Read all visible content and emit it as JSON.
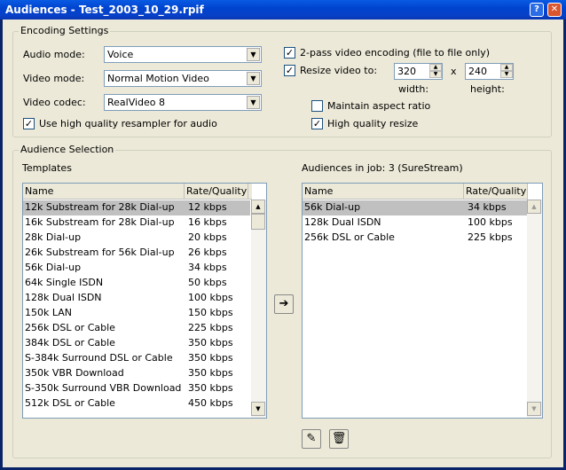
{
  "window": {
    "title": "Audiences - Test_2003_10_29.rpif",
    "help_glyph": "?",
    "close_glyph": "✕"
  },
  "encoding": {
    "group_label": "Encoding Settings",
    "audio_mode_label": "Audio mode:",
    "audio_mode_value": "Voice",
    "video_mode_label": "Video mode:",
    "video_mode_value": "Normal Motion Video",
    "video_codec_label": "Video codec:",
    "video_codec_value": "RealVideo 8",
    "resampler_label": "Use high quality resampler for audio",
    "resampler_checked": true,
    "twopass_label": "2-pass video encoding (file to file only)",
    "twopass_checked": true,
    "resize_label": "Resize video to:",
    "resize_checked": true,
    "width_value": "320",
    "height_value": "240",
    "x_sep": "x",
    "width_label": "width:",
    "height_label": "height:",
    "aspect_label": "Maintain aspect ratio",
    "aspect_checked": false,
    "hq_resize_label": "High quality resize",
    "hq_resize_checked": true
  },
  "audience": {
    "group_label": "Audience Selection",
    "templates_label": "Templates",
    "in_job_label": "Audiences in job: 3  (SureStream)",
    "col_name": "Name",
    "col_rate": "Rate/Quality",
    "templates": [
      {
        "name": "12k Substream for 28k Dial-up",
        "rate": "12 kbps"
      },
      {
        "name": "16k Substream for 28k Dial-up",
        "rate": "16 kbps"
      },
      {
        "name": "28k Dial-up",
        "rate": "20 kbps"
      },
      {
        "name": "26k Substream for 56k Dial-up",
        "rate": "26 kbps"
      },
      {
        "name": "56k Dial-up",
        "rate": "34 kbps"
      },
      {
        "name": "64k Single ISDN",
        "rate": "50 kbps"
      },
      {
        "name": "128k Dual ISDN",
        "rate": "100 kbps"
      },
      {
        "name": "150k LAN",
        "rate": "150 kbps"
      },
      {
        "name": "256k DSL or Cable",
        "rate": "225 kbps"
      },
      {
        "name": "384k DSL or Cable",
        "rate": "350 kbps"
      },
      {
        "name": "S-384k Surround DSL or Cable",
        "rate": "350 kbps"
      },
      {
        "name": "350k VBR Download",
        "rate": "350 kbps"
      },
      {
        "name": "S-350k Surround VBR Download",
        "rate": "350 kbps"
      },
      {
        "name": "512k DSL or Cable",
        "rate": "450 kbps"
      }
    ],
    "in_job": [
      {
        "name": "56k Dial-up",
        "rate": "34 kbps"
      },
      {
        "name": "128k Dual ISDN",
        "rate": "100 kbps"
      },
      {
        "name": "256k DSL or Cable",
        "rate": "225 kbps"
      }
    ],
    "add_glyph": "➔",
    "edit_glyph": "✎",
    "delete_glyph": "🗑"
  }
}
